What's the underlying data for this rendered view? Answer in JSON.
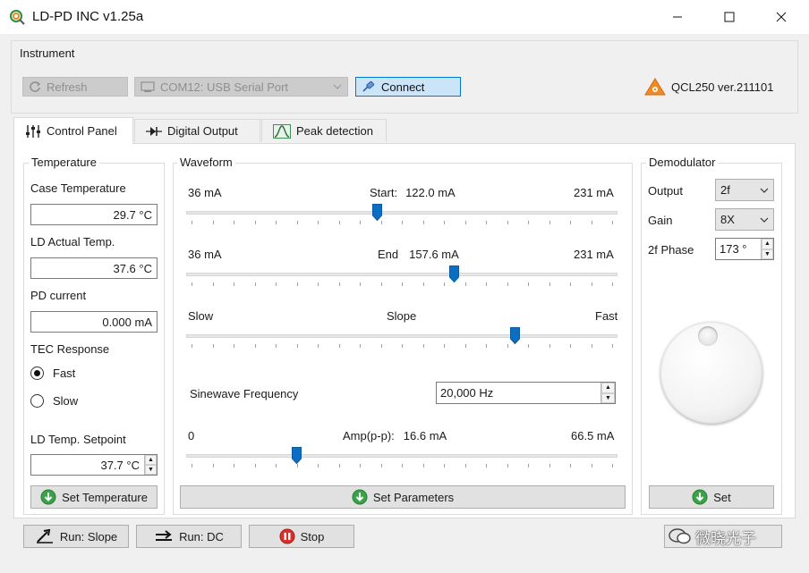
{
  "window": {
    "title": "LD-PD INC v1.25a",
    "controls": [
      "minimize-icon",
      "maximize-icon",
      "close-icon"
    ]
  },
  "instrument": {
    "label": "Instrument",
    "refresh_label": "Refresh",
    "port_value": "COM12: USB Serial Port",
    "connect_label": "Connect",
    "device": "QCL250 ver.211101"
  },
  "tabs": [
    {
      "label": "Control Panel",
      "icon": "sliders-icon",
      "active": true
    },
    {
      "label": "Digital Output",
      "icon": "diode-icon",
      "active": false
    },
    {
      "label": "Peak detection",
      "icon": "peak-icon",
      "active": false
    }
  ],
  "temperature": {
    "title": "Temperature",
    "case_label": "Case Temperature",
    "case_value": "29.7 °C",
    "ld_label": "LD Actual Temp.",
    "ld_value": "37.6 °C",
    "pd_label": "PD current",
    "pd_value": "0.000 mA",
    "tec_label": "TEC Response",
    "fast_label": "Fast",
    "slow_label": "Slow",
    "tec_selected": "Fast",
    "setpoint_label": "LD Temp. Setpoint",
    "setpoint_value": "37.7 °C",
    "set_button": "Set Temperature"
  },
  "waveform": {
    "title": "Waveform",
    "start": {
      "min_label": "36 mA",
      "caption": "Start:",
      "value_label": "122.0 mA",
      "max_label": "231 mA",
      "min": 36,
      "max": 231,
      "value": 122.0
    },
    "end": {
      "min_label": "36 mA",
      "caption": "End",
      "value_label": "157.6 mA",
      "max_label": "231 mA",
      "min": 36,
      "max": 231,
      "value": 157.6
    },
    "slope": {
      "min_label": "Slow",
      "caption": "Slope",
      "max_label": "Fast",
      "fraction": 0.77
    },
    "sine_label": "Sinewave Frequency",
    "sine_value": "20,000 Hz",
    "amp": {
      "min_label": "0",
      "caption": "Amp(p-p):",
      "value_label": "16.6 mA",
      "max_label": "66.5 mA",
      "min": 0,
      "max": 66.5,
      "value": 16.6
    },
    "set_button": "Set Parameters"
  },
  "demodulator": {
    "title": "Demodulator",
    "output_label": "Output",
    "output_value": "2f",
    "gain_label": "Gain",
    "gain_value": "8X",
    "phase_label": "2f Phase",
    "phase_value": "173 °",
    "set_button": "Set"
  },
  "bottom": {
    "run_slope": "Run: Slope",
    "run_dc": "Run: DC",
    "stop": "Stop",
    "watermark": "微晓光子"
  },
  "colors": {
    "slider_thumb": "#0a6fc2",
    "ok_green": "#3aa34a",
    "stop_red": "#d9302c",
    "warning_orange": "#f08a24",
    "connect_highlight": "#cce4f7"
  }
}
